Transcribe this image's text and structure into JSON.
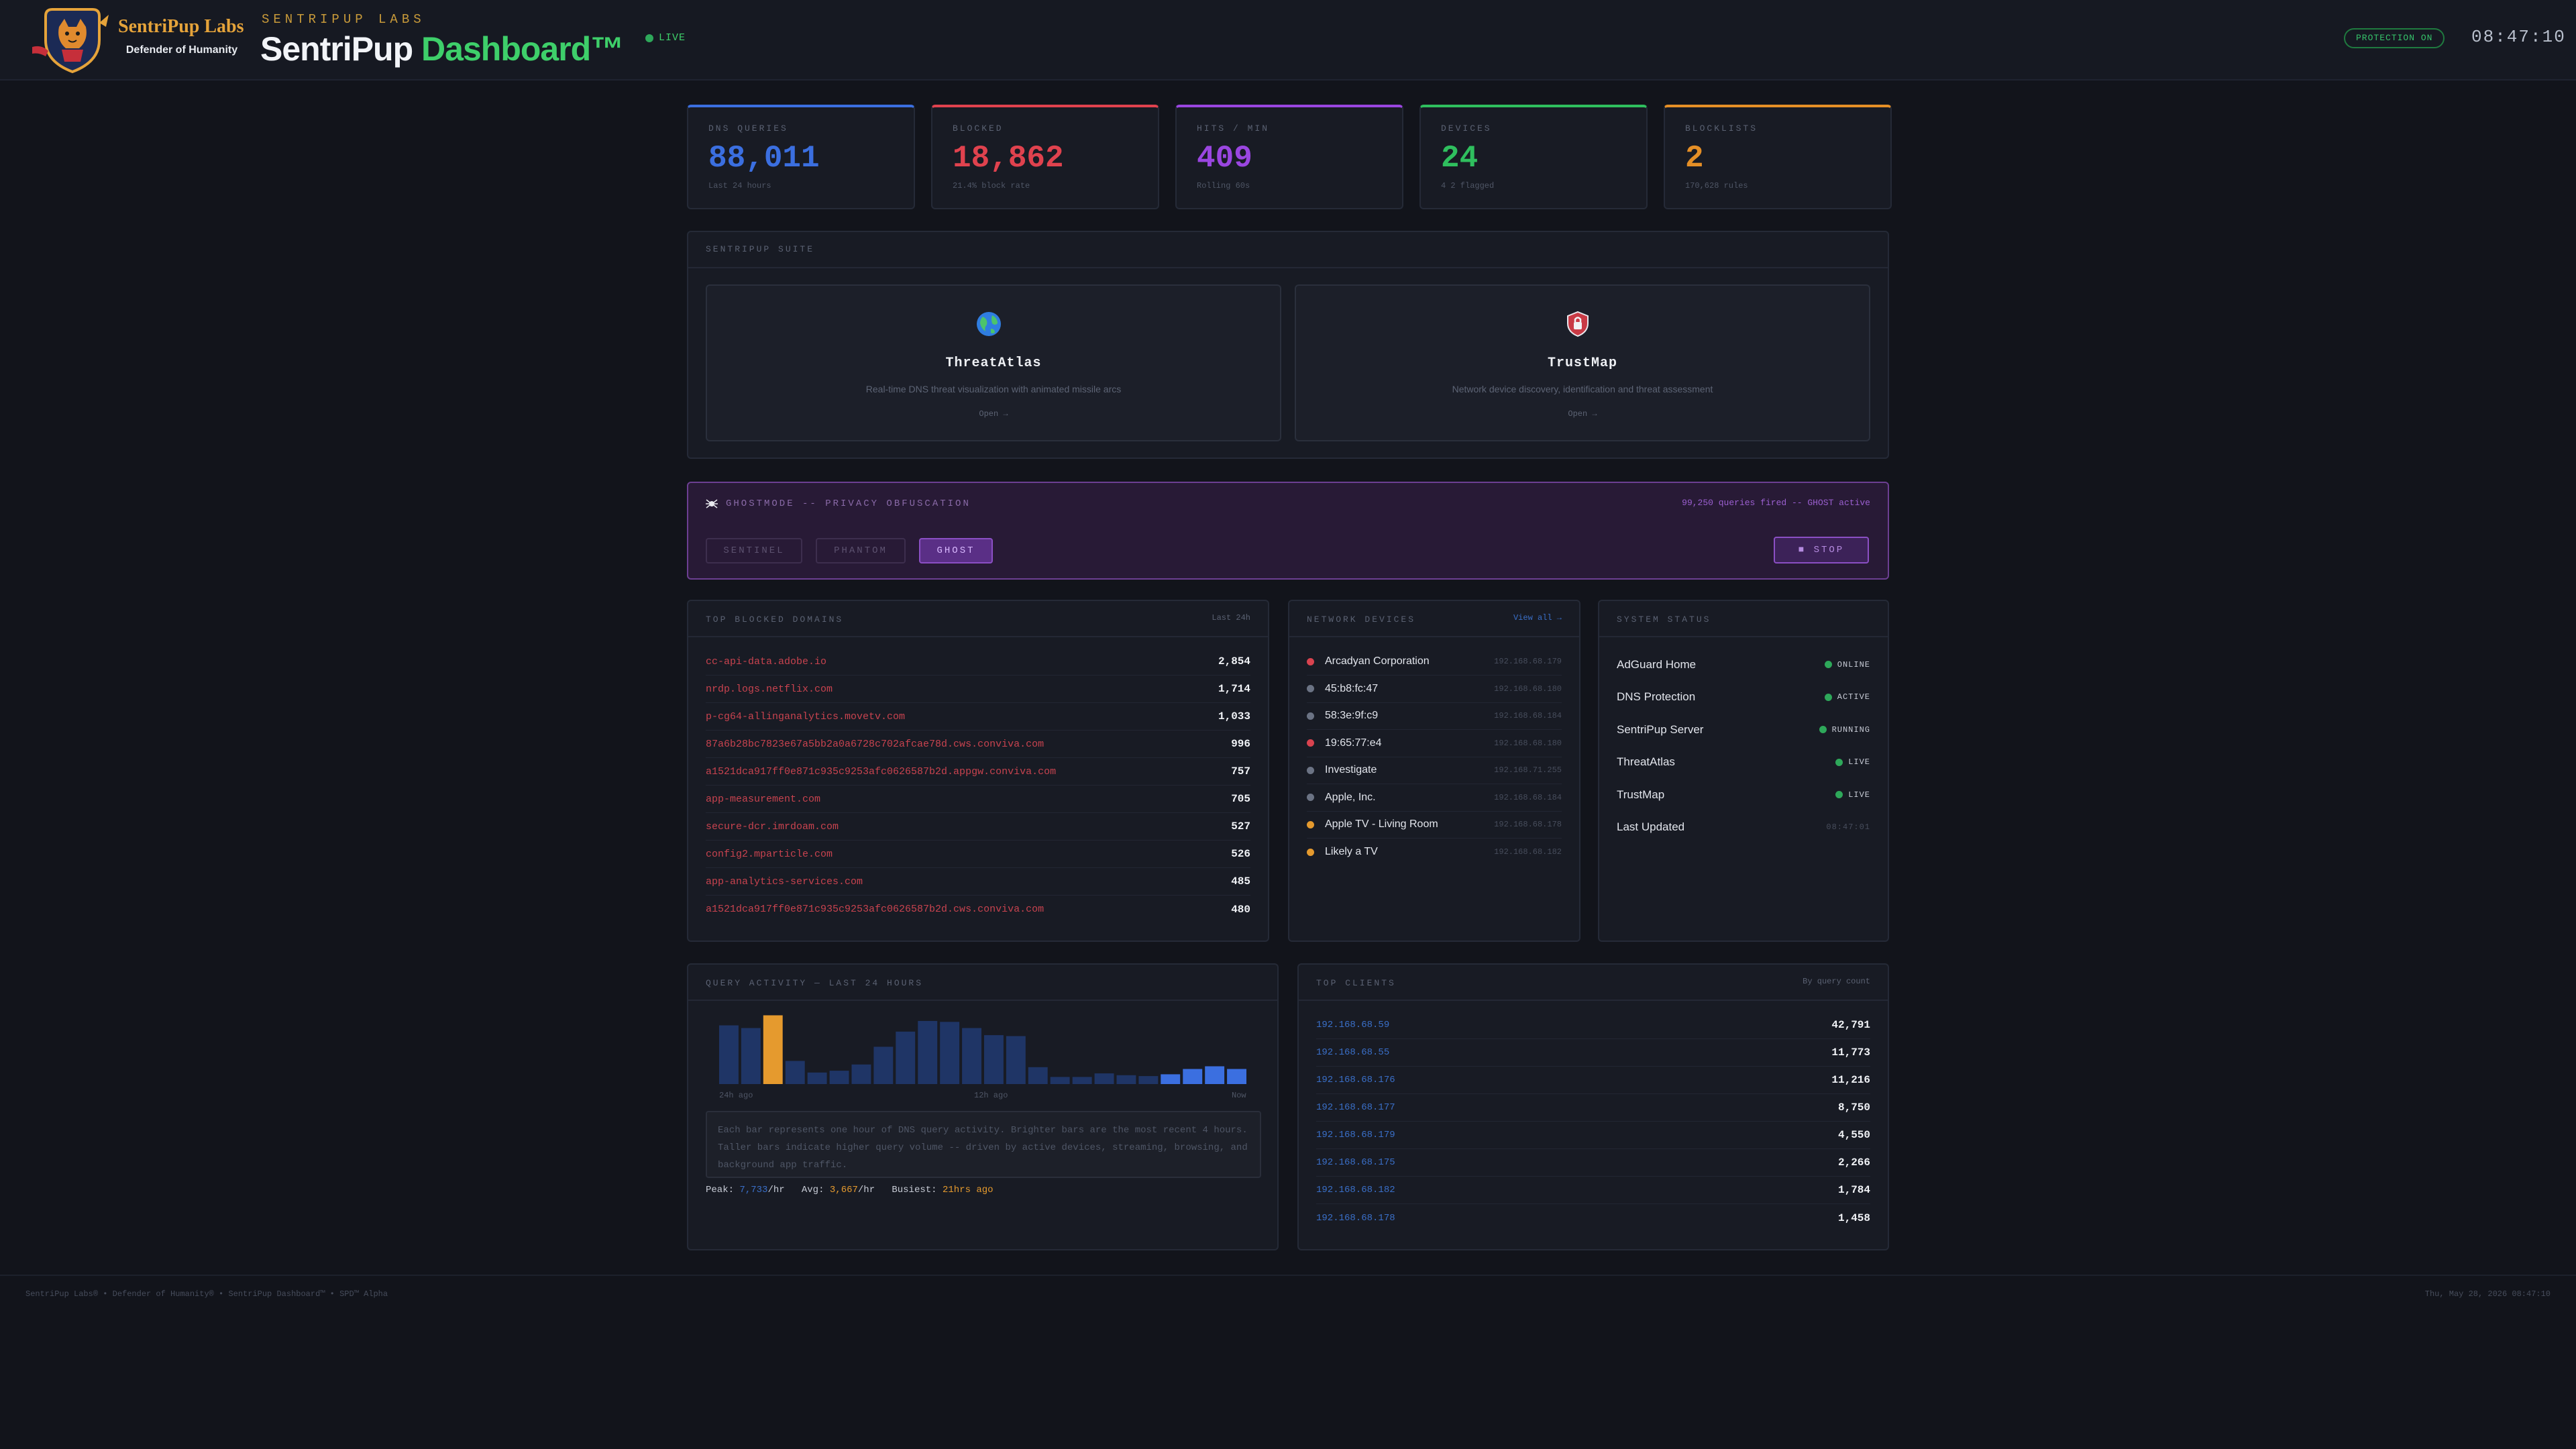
{
  "header": {
    "brand_name": "SentriPup Labs",
    "brand_tagline": "Defender of Humanity",
    "app_kicker": "SENTRIPUP LABS",
    "title_part1": "SentriPup",
    "title_part2": "Dashboard™",
    "live_label": "LIVE",
    "protection_label": "PROTECTION ON",
    "clock": "08:47:10"
  },
  "stats": [
    {
      "label": "DNS QUERIES",
      "value": "88,011",
      "sub": "Last 24 hours",
      "color": "#3b6fe0"
    },
    {
      "label": "BLOCKED",
      "value": "18,862",
      "sub": "21.4% block rate",
      "color": "#e0424e"
    },
    {
      "label": "HITS / MIN",
      "value": "409",
      "sub": "Rolling 60s",
      "color": "#9a46e0"
    },
    {
      "label": "DEVICES",
      "value": "24",
      "sub": "4 2 flagged",
      "color": "#2fbf5e"
    },
    {
      "label": "BLOCKLISTS",
      "value": "2",
      "sub": "170,628 rules",
      "color": "#e58f26"
    }
  ],
  "suite": {
    "label": "SENTRIPUP SUITE",
    "tools": [
      {
        "name": "ThreatAtlas",
        "desc": "Real-time DNS threat visualization with animated missile arcs",
        "open": "Open →",
        "icon": "globe-icon"
      },
      {
        "name": "TrustMap",
        "desc": "Network device discovery, identification and threat assessment",
        "open": "Open →",
        "icon": "shield-icon"
      }
    ]
  },
  "ghost": {
    "title": "GHOSTMODE -- PRIVACY OBFUSCATION",
    "status": "99,250 queries fired -- GHOST active",
    "modes": [
      "SENTINEL",
      "PHANTOM",
      "GHOST"
    ],
    "active_mode": "GHOST",
    "stop_label": "■ STOP"
  },
  "blocked_domains": {
    "label": "TOP BLOCKED DOMAINS",
    "range": "Last 24h",
    "rows": [
      {
        "domain": "cc-api-data.adobe.io",
        "count": "2,854"
      },
      {
        "domain": "nrdp.logs.netflix.com",
        "count": "1,714"
      },
      {
        "domain": "p-cg64-allinganalytics.movetv.com",
        "count": "1,033"
      },
      {
        "domain": "87a6b28bc7823e67a5bb2a0a6728c702afcae78d.cws.conviva.com",
        "count": "996"
      },
      {
        "domain": "a1521dca917ff0e871c935c9253afc0626587b2d.appgw.conviva.com",
        "count": "757"
      },
      {
        "domain": "app-measurement.com",
        "count": "705"
      },
      {
        "domain": "secure-dcr.imrdoam.com",
        "count": "527"
      },
      {
        "domain": "config2.mparticle.com",
        "count": "526"
      },
      {
        "domain": "app-analytics-services.com",
        "count": "485"
      },
      {
        "domain": "a1521dca917ff0e871c935c9253afc0626587b2d.cws.conviva.com",
        "count": "480"
      }
    ]
  },
  "devices": {
    "label": "NETWORK DEVICES",
    "view_all": "View all →",
    "rows": [
      {
        "name": "Arcadyan Corporation",
        "ip": "192.168.68.179",
        "color": "#d9434f"
      },
      {
        "name": "45:b8:fc:47",
        "ip": "192.168.68.180",
        "color": "#6b7384"
      },
      {
        "name": "58:3e:9f:c9",
        "ip": "192.168.68.184",
        "color": "#6b7384"
      },
      {
        "name": "19:65:77:e4",
        "ip": "192.168.68.180",
        "color": "#d9434f"
      },
      {
        "name": "Investigate",
        "ip": "192.168.71.255",
        "color": "#6b7384"
      },
      {
        "name": "Apple, Inc.",
        "ip": "192.168.68.184",
        "color": "#6b7384"
      },
      {
        "name": "Apple TV - Living Room",
        "ip": "192.168.68.178",
        "color": "#e59a2e"
      },
      {
        "name": "Likely a TV",
        "ip": "192.168.68.182",
        "color": "#e59a2e"
      }
    ]
  },
  "system": {
    "label": "SYSTEM STATUS",
    "rows": [
      {
        "name": "AdGuard Home",
        "status": "ONLINE"
      },
      {
        "name": "DNS Protection",
        "status": "ACTIVE"
      },
      {
        "name": "SentriPup Server",
        "status": "RUNNING"
      },
      {
        "name": "ThreatAtlas",
        "status": "LIVE"
      },
      {
        "name": "TrustMap",
        "status": "LIVE"
      },
      {
        "name": "Last Updated",
        "status": "08:47:01"
      }
    ]
  },
  "activity": {
    "label": "QUERY ACTIVITY — LAST 24 HOURS",
    "axis_left": "24h ago",
    "axis_mid": "12h ago",
    "axis_right": "Now",
    "note": "Each bar represents one hour of DNS query activity. Brighter bars are the most recent 4 hours. Taller bars indicate higher query volume -- driven by active devices, streaming, browsing, and background app traffic.",
    "peak_label": "Peak:",
    "peak_value": "7,733",
    "avg_label": "Avg:",
    "avg_value": "3,667",
    "per_hr": "/hr",
    "busiest_label": "Busiest:",
    "busiest_value": "21hrs ago"
  },
  "chart_data": {
    "type": "bar",
    "title": "QUERY ACTIVITY — LAST 24 HOURS",
    "xlabel": "",
    "ylabel": "",
    "x_ticks": [
      "24h ago",
      "12h ago",
      "Now"
    ],
    "values": [
      6600,
      6300,
      7733,
      2600,
      1300,
      1500,
      2200,
      4200,
      5900,
      7100,
      7000,
      6300,
      5500,
      5400,
      1900,
      800,
      800,
      1200,
      1000,
      900,
      1100,
      1700,
      2000,
      1700
    ],
    "highlight_index": 2,
    "highlight_color": "#e59a2e",
    "base_color": "#1f3566",
    "recent_color": "#3b6fe0",
    "recent_count": 4,
    "ylim": [
      0,
      8000
    ]
  },
  "clients": {
    "label": "TOP CLIENTS",
    "sort_label": "By query count",
    "rows": [
      {
        "ip": "192.168.68.59",
        "count": "42,791"
      },
      {
        "ip": "192.168.68.55",
        "count": "11,773"
      },
      {
        "ip": "192.168.68.176",
        "count": "11,216"
      },
      {
        "ip": "192.168.68.177",
        "count": "8,750"
      },
      {
        "ip": "192.168.68.179",
        "count": "4,550"
      },
      {
        "ip": "192.168.68.175",
        "count": "2,266"
      },
      {
        "ip": "192.168.68.182",
        "count": "1,784"
      },
      {
        "ip": "192.168.68.178",
        "count": "1,458"
      }
    ]
  },
  "footer": {
    "left": "SentriPup Labs®  •  Defender of Humanity®  •  SentriPup Dashboard™  •  SPD™ Alpha",
    "right": "Thu, May 28, 2026 08:47:10"
  }
}
